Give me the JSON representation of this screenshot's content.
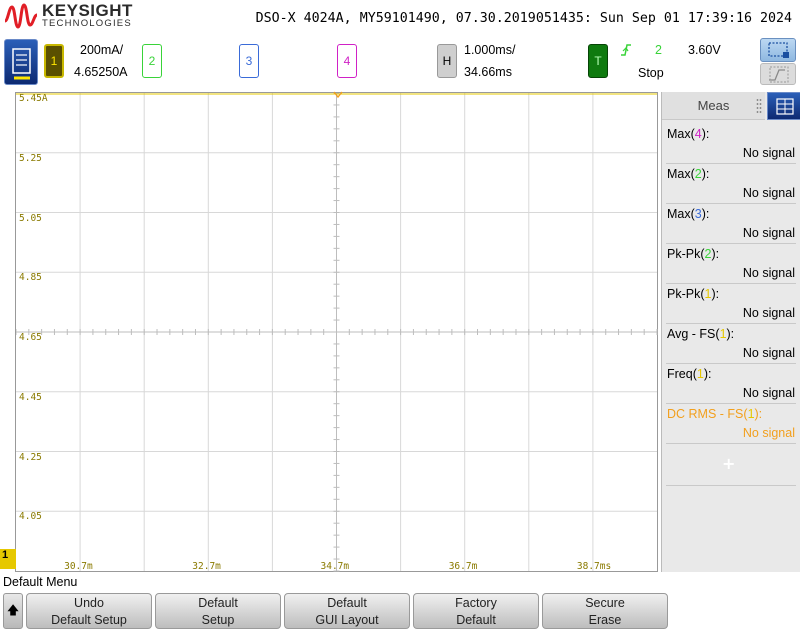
{
  "brand": {
    "name": "KEYSIGHT",
    "subtitle": "TECHNOLOGIES",
    "logo_color": "#e11e26"
  },
  "instrument_info": "DSO-X 4024A, MY59101490, 07.30.2019051435: Sun Sep 01 17:39:16 2024",
  "channels": {
    "ch1": {
      "label": "1",
      "scale": "200mA/",
      "offset": "4.65250A",
      "color": "#e6c800"
    },
    "ch2": {
      "label": "2",
      "color": "#39d339"
    },
    "ch3": {
      "label": "3",
      "color": "#3a6bd8"
    },
    "ch4": {
      "label": "4",
      "color": "#d021c6"
    }
  },
  "horizontal": {
    "label": "H",
    "timebase": "1.000ms/",
    "delay": "34.66ms"
  },
  "trigger": {
    "label": "T",
    "source": "2",
    "level": "3.60V",
    "state": "Stop",
    "slope_icon": "rising-edge-icon"
  },
  "graticule": {
    "v_labels": [
      "5.45A",
      "5.25",
      "5.05",
      "4.85",
      "4.65",
      "4.45",
      "4.25",
      "4.05"
    ],
    "h_labels": [
      "30.7m",
      "32.7m",
      "34.7m",
      "36.7m",
      "38.7ms"
    ],
    "ground_marker": "1"
  },
  "meas": {
    "tab_label": "Meas",
    "items": [
      {
        "prefix": "Max(",
        "ch": "4",
        "suffix": "):",
        "value": "No signal"
      },
      {
        "prefix": "Max(",
        "ch": "2",
        "suffix": "):",
        "value": "No signal"
      },
      {
        "prefix": "Max(",
        "ch": "3",
        "suffix": "):",
        "value": "No signal"
      },
      {
        "prefix": "Pk-Pk(",
        "ch": "2",
        "suffix": "):",
        "value": "No signal"
      },
      {
        "prefix": "Pk-Pk(",
        "ch": "1",
        "suffix": "):",
        "value": "No signal"
      },
      {
        "prefix": "Avg - FS(",
        "ch": "1",
        "suffix": "):",
        "value": "No signal"
      },
      {
        "prefix": "Freq(",
        "ch": "1",
        "suffix": "):",
        "value": "No signal"
      },
      {
        "prefix": "DC RMS - FS(",
        "ch": "1",
        "suffix": "):",
        "value": "No signal"
      }
    ],
    "add_label": "+"
  },
  "menu": {
    "title": "Default Menu",
    "back_label": "🡅",
    "softkeys": [
      {
        "line1": "Undo",
        "line2": "Default Setup"
      },
      {
        "line1": "Default",
        "line2": "Setup"
      },
      {
        "line1": "Default",
        "line2": "GUI Layout"
      },
      {
        "line1": "Factory",
        "line2": "Default"
      },
      {
        "line1": "Secure",
        "line2": "Erase"
      }
    ]
  }
}
